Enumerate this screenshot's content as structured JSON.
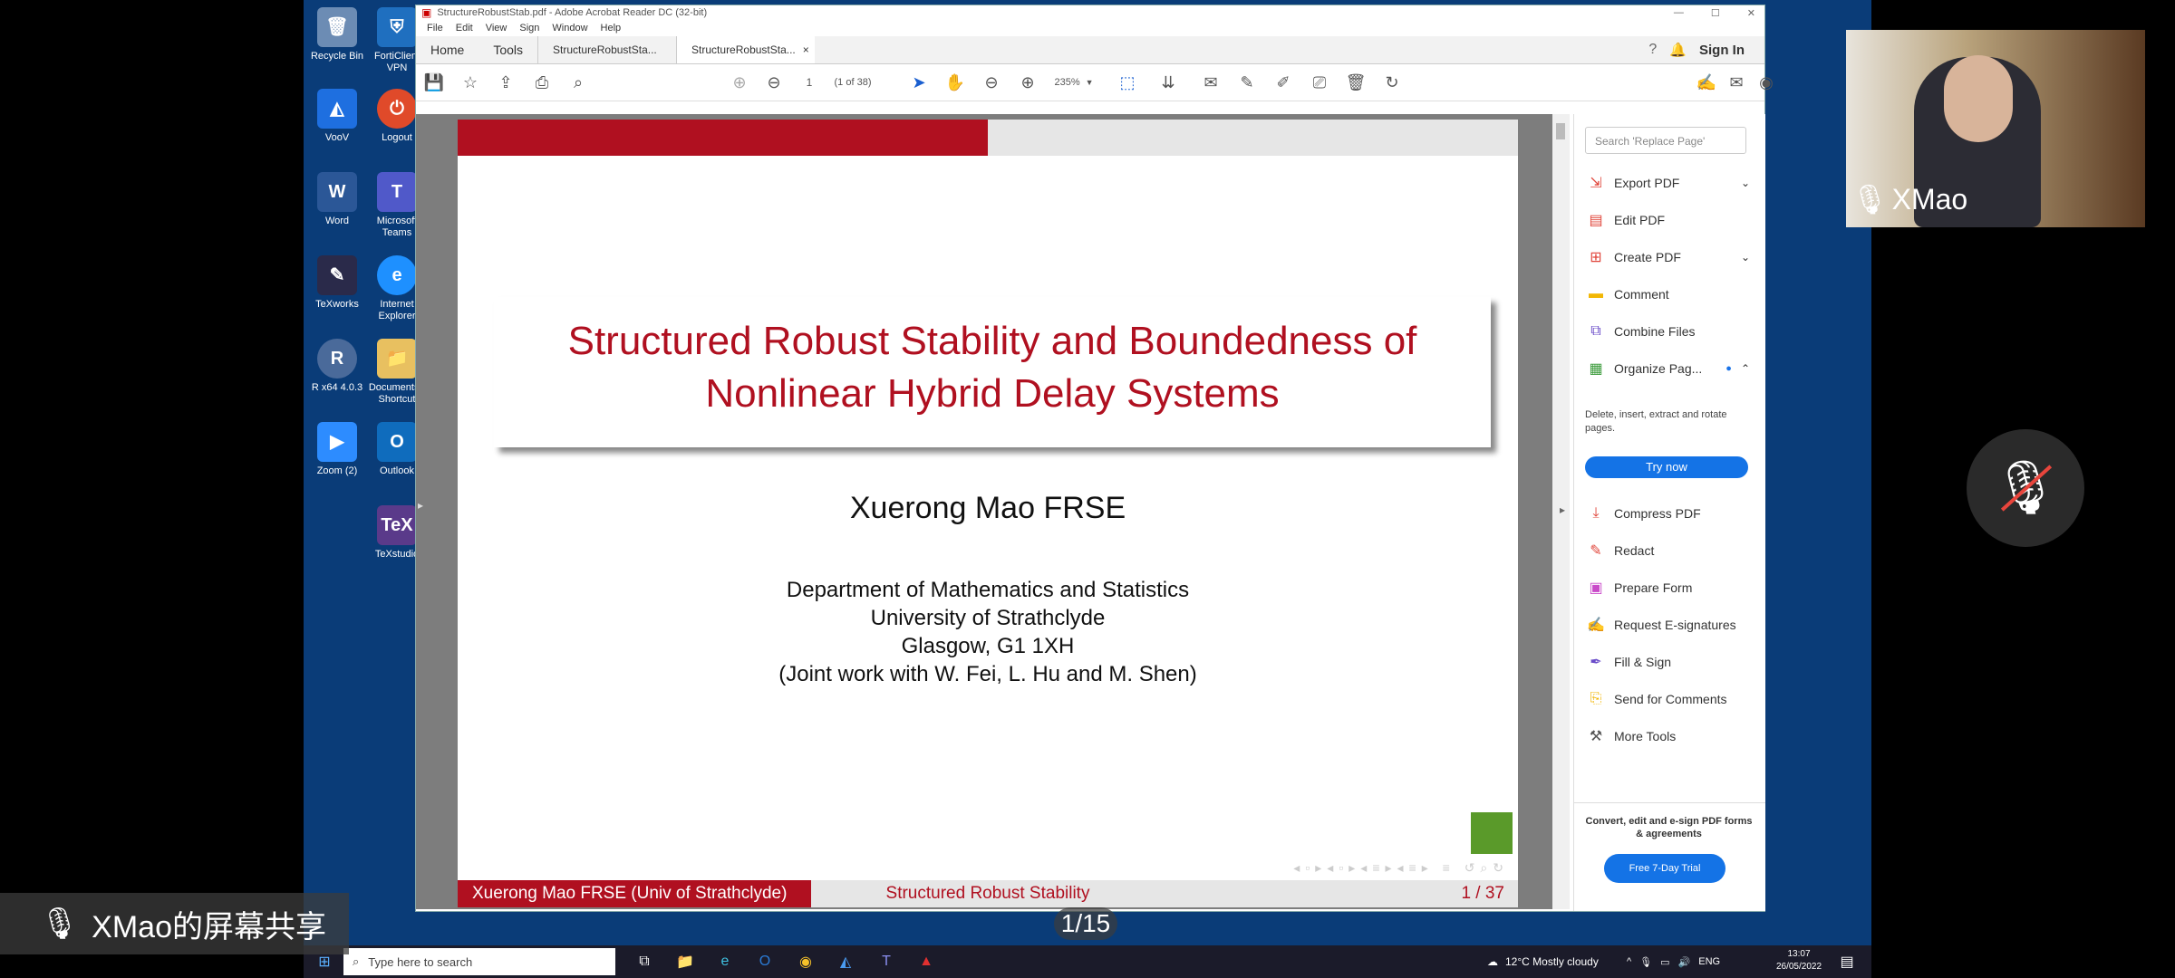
{
  "desktop_icons": [
    {
      "label": "Recycle Bin",
      "icon": "recycle-bin-icon",
      "color": "#6c8cb4"
    },
    {
      "label": "FortiClient VPN",
      "icon": "forticlient-icon",
      "color": "#1f6fbf"
    },
    {
      "label": "VooV",
      "icon": "voov-icon",
      "color": "#1e6fe0"
    },
    {
      "label": "Logout",
      "icon": "logout-icon",
      "color": "#e04a2a"
    },
    {
      "label": "Word",
      "icon": "word-icon",
      "color": "#2b5797"
    },
    {
      "label": "Microsoft Teams",
      "icon": "teams-icon",
      "color": "#5059c9"
    },
    {
      "label": "TeXworks",
      "icon": "texworks-icon",
      "color": "#2a2a4a"
    },
    {
      "label": "Internet Explorer",
      "icon": "internet-explorer-icon",
      "color": "#1e90ff"
    },
    {
      "label": "R x64 4.0.3",
      "icon": "r-icon",
      "color": "#4a6a9a"
    },
    {
      "label": "Documents - Shortcut",
      "icon": "documents-folder-icon",
      "color": "#e8c060"
    },
    {
      "label": "Zoom (2)",
      "icon": "zoom-icon",
      "color": "#2d8cff"
    },
    {
      "label": "Outlook",
      "icon": "outlook-icon",
      "color": "#0f6cbd"
    },
    {
      "label": "TeXstudio",
      "icon": "texstudio-icon",
      "color": "#5a3a8a"
    }
  ],
  "window": {
    "title": "StructureRobustStab.pdf - Adobe Acrobat Reader DC (32-bit)",
    "menu": [
      "File",
      "Edit",
      "View",
      "Sign",
      "Window",
      "Help"
    ],
    "tabs": {
      "home": "Home",
      "tools": "Tools",
      "doc1": "StructureRobustSta...",
      "doc2": "StructureRobustSta...",
      "close": "×"
    },
    "sign_in": "Sign In",
    "page_input": "1",
    "page_of": "(1 of 38)",
    "zoom": "235%"
  },
  "slide": {
    "title_line1": "Structured Robust Stability and Boundedness of",
    "title_line2": "Nonlinear Hybrid Delay Systems",
    "author": "Xuerong Mao FRSE",
    "affil1": "Department of Mathematics and Statistics",
    "affil2": "University of Strathclyde",
    "affil3": "Glasgow, G1 1XH",
    "affil4": "(Joint work with W. Fei, L. Hu and M. Shen)",
    "footer_left": "Xuerong Mao FRSE  (Univ of Strathclyde)",
    "footer_mid": "Structured Robust Stability",
    "footer_right": "1 / 37",
    "accent": "#b01020",
    "logo_color": "#5a9a2a"
  },
  "right_pane": {
    "search_placeholder": "Search 'Replace Page'",
    "items_top": [
      {
        "label": "Export PDF",
        "icon": "export-pdf-icon",
        "color": "#e0453a",
        "chevron": "down"
      },
      {
        "label": "Edit PDF",
        "icon": "edit-pdf-icon",
        "color": "#e0453a"
      },
      {
        "label": "Create PDF",
        "icon": "create-pdf-icon",
        "color": "#e0453a",
        "chevron": "down"
      },
      {
        "label": "Comment",
        "icon": "comment-icon",
        "color": "#f2b705"
      },
      {
        "label": "Combine Files",
        "icon": "combine-files-icon",
        "color": "#6a4cc9"
      },
      {
        "label": "Organize Pag...",
        "icon": "organize-pages-icon",
        "color": "#3a9a3a",
        "chevron": "up"
      }
    ],
    "organize_desc": "Delete, insert, extract and rotate pages.",
    "try_now": "Try now",
    "items_bottom": [
      {
        "label": "Compress PDF",
        "icon": "compress-pdf-icon",
        "color": "#e0453a"
      },
      {
        "label": "Redact",
        "icon": "redact-icon",
        "color": "#e0453a"
      },
      {
        "label": "Prepare Form",
        "icon": "prepare-form-icon",
        "color": "#c94ac9"
      },
      {
        "label": "Request E-signatures",
        "icon": "request-esignatures-icon",
        "color": "#c94ac9"
      },
      {
        "label": "Fill & Sign",
        "icon": "fill-sign-icon",
        "color": "#6a4cc9"
      },
      {
        "label": "Send for Comments",
        "icon": "send-for-comments-icon",
        "color": "#f2b705"
      },
      {
        "label": "More Tools",
        "icon": "more-tools-icon",
        "color": "#555555"
      }
    ],
    "promo": "Convert, edit and e-sign PDF forms & agreements",
    "trial": "Free 7-Day Trial"
  },
  "taskbar": {
    "search_placeholder": "Type here to search",
    "weather": "12°C  Mostly cloudy",
    "lang": "ENG",
    "time": "13:07",
    "date": "26/05/2022"
  },
  "meeting": {
    "speaker": "XMao",
    "share_label": "XMao的屏幕共享",
    "page_counter": "1/15"
  }
}
